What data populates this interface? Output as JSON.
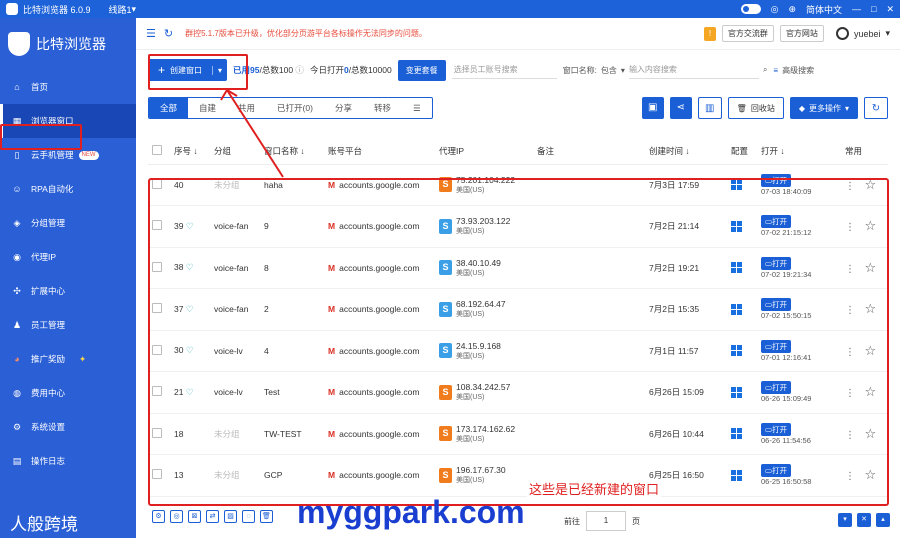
{
  "titlebar": {
    "app_name": "比特浏览器 6.0.9",
    "line": "线路1",
    "language": "简体中文",
    "icons": [
      "toggle-icon",
      "fingerprint-icon",
      "globe-icon",
      "minimize-icon",
      "maximize-icon",
      "close-icon"
    ]
  },
  "sidebar": {
    "brand": "比特浏览器",
    "items": [
      {
        "label": "首页",
        "icon": "home-icon"
      },
      {
        "label": "浏览器窗口",
        "icon": "grid-icon",
        "active": true
      },
      {
        "label": "云手机管理",
        "icon": "phone-icon",
        "badge": "NEW"
      },
      {
        "label": "RPA自动化",
        "icon": "robot-icon"
      },
      {
        "label": "分组管理",
        "icon": "group-icon"
      },
      {
        "label": "代理IP",
        "icon": "location-icon"
      },
      {
        "label": "扩展中心",
        "icon": "puzzle-icon"
      },
      {
        "label": "员工管理",
        "icon": "users-icon"
      },
      {
        "label": "推广奖励",
        "icon": "gift-icon"
      },
      {
        "label": "费用中心",
        "icon": "wallet-icon"
      },
      {
        "label": "系统设置",
        "icon": "settings-icon"
      },
      {
        "label": "操作日志",
        "icon": "log-icon"
      }
    ],
    "bottom_text": "人般跨境"
  },
  "topbar": {
    "notice": "群控5.1.7版本已升级，优化部分页游平台各标操作无法同步的问题。",
    "exchange_btn": "官方交流群",
    "website_btn": "官方网站",
    "username": "yuebei"
  },
  "toolbar": {
    "create_btn": "创建窗口",
    "used": "已用95",
    "total": "/总数100",
    "today_label": "今日打开",
    "today": "0",
    "today_total": "/总数10000",
    "change_pkg": "变更套餐",
    "staff_placeholder": "选择员工账号搜索",
    "window_name_label": "窗口名称:",
    "match": "包含",
    "search_placeholder": "输入内容搜索",
    "advanced": "高级搜索"
  },
  "tabs": [
    "全部",
    "自建",
    "共用",
    "已打开(0)",
    "分享",
    "转移"
  ],
  "actions": {
    "recycle": "回收站",
    "more": "更多操作"
  },
  "columns": [
    "序号",
    "分组",
    "窗口名称",
    "账号平台",
    "代理IP",
    "备注",
    "创建时间",
    "配置",
    "打开",
    "常用"
  ],
  "rows": [
    {
      "seq": "40",
      "group": "未分组",
      "name": "haha",
      "platform": "accounts.google.com",
      "ip": "75.201.104.222",
      "region": "美国(US)",
      "iptype": "o",
      "created": "7月3日 17:59",
      "open_label": "打开",
      "opened": "07-03 18:40:09",
      "gray": true,
      "heart": false
    },
    {
      "seq": "39",
      "group": "voice-fan",
      "name": "9",
      "platform": "accounts.google.com",
      "ip": "73.93.203.122",
      "region": "美国(US)",
      "iptype": "b",
      "created": "7月2日 21:14",
      "open_label": "打开",
      "opened": "07-02 21:15:12",
      "gray": false,
      "heart": true
    },
    {
      "seq": "38",
      "group": "voice-fan",
      "name": "8",
      "platform": "accounts.google.com",
      "ip": "38.40.10.49",
      "region": "美国(US)",
      "iptype": "b",
      "created": "7月2日 19:21",
      "open_label": "打开",
      "opened": "07-02 19:21:34",
      "gray": false,
      "heart": true
    },
    {
      "seq": "37",
      "group": "voice-fan",
      "name": "2",
      "platform": "accounts.google.com",
      "ip": "68.192.64.47",
      "region": "美国(US)",
      "iptype": "b",
      "created": "7月2日 15:35",
      "open_label": "打开",
      "opened": "07-02 15:50:15",
      "gray": false,
      "heart": true
    },
    {
      "seq": "30",
      "group": "voice-lv",
      "name": "4",
      "platform": "accounts.google.com",
      "ip": "24.15.9.168",
      "region": "美国(US)",
      "iptype": "b",
      "created": "7月1日 11:57",
      "open_label": "打开",
      "opened": "07-01 12:16:41",
      "gray": false,
      "heart": true
    },
    {
      "seq": "21",
      "group": "voice-lv",
      "name": "Test",
      "platform": "accounts.google.com",
      "ip": "108.34.242.57",
      "region": "美国(US)",
      "iptype": "o",
      "created": "6月26日 15:09",
      "open_label": "打开",
      "opened": "06-26 15:09:49",
      "gray": false,
      "heart": true
    },
    {
      "seq": "18",
      "group": "未分组",
      "name": "TW-TEST",
      "platform": "accounts.google.com",
      "ip": "173.174.162.62",
      "region": "美国(US)",
      "iptype": "o",
      "created": "6月26日 10:44",
      "open_label": "打开",
      "opened": "06-26 11:54:56",
      "gray": true,
      "heart": false
    },
    {
      "seq": "13",
      "group": "未分组",
      "name": "GCP",
      "platform": "accounts.google.com",
      "ip": "196.17.67.30",
      "region": "美国(US)",
      "iptype": "o",
      "created": "6月25日 16:50",
      "open_label": "打开",
      "opened": "06-25 16:50:58",
      "gray": true,
      "heart": false
    }
  ],
  "pager": {
    "prev": "前往",
    "page": "1",
    "unit": "页"
  },
  "annotation": "这些是已经新建的窗口",
  "watermark": "myggpark.com"
}
